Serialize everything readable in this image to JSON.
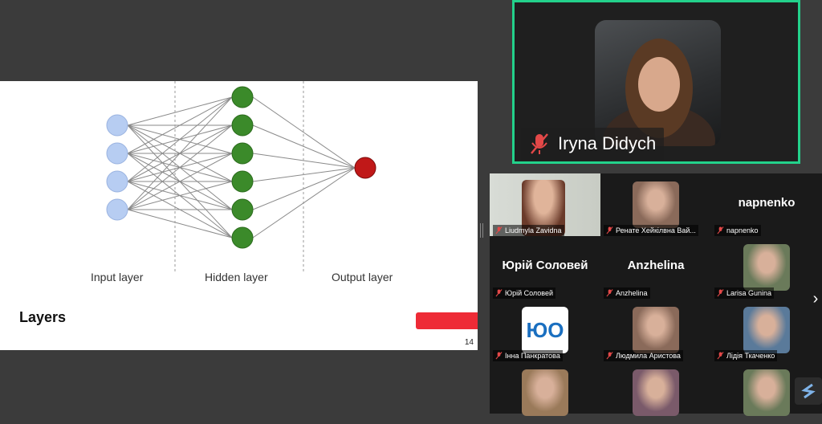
{
  "slide": {
    "layer_labels": [
      "Input layer",
      "Hidden layer",
      "Output layer"
    ],
    "title": "Layers",
    "page_number": "14",
    "colors": {
      "input_node": "#b7cdf2",
      "hidden_node": "#3b8a2a",
      "output_node": "#c01818",
      "accent_bar": "#ee2b36"
    }
  },
  "speaker": {
    "name": "Iryna Didych",
    "mic_icon": "mic-muted-icon",
    "border_color": "#23d18b"
  },
  "gallery": {
    "tiles": [
      {
        "name": "Liudmyla Zavidna",
        "type": "video"
      },
      {
        "name": "Ренате Хейкілвна Вай...",
        "type": "photo"
      },
      {
        "name": "napnenko",
        "big_label": "napnenko",
        "type": "name"
      },
      {
        "name": "Юрій Соловей",
        "big_label": "Юрій Соловей",
        "type": "name"
      },
      {
        "name": "Anzhelina",
        "big_label": "Anzhelina",
        "type": "name"
      },
      {
        "name": "Larisa Gunina",
        "type": "photo"
      },
      {
        "name": "Інна Панкратова",
        "type": "logo",
        "logo_text": "ЮО"
      },
      {
        "name": "Людмила Аристова",
        "type": "photo"
      },
      {
        "name": "Лідія Ткаченко",
        "type": "photo"
      },
      {
        "name": "",
        "type": "photo"
      },
      {
        "name": "",
        "type": "photo"
      },
      {
        "name": "",
        "type": "photo"
      }
    ],
    "next_icon": "chevron-right-icon"
  }
}
